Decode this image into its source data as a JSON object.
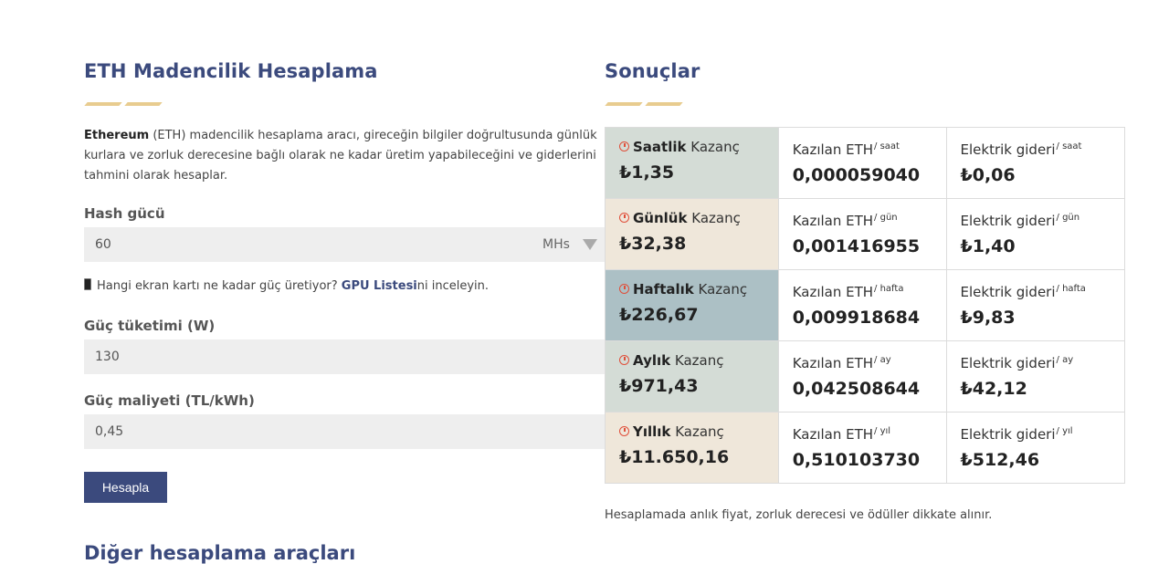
{
  "calculator": {
    "title": "ETH Madencilik Hesaplama",
    "intro_bold": "Ethereum",
    "intro_rest": " (ETH) madencilik hesaplama aracı, gireceğin bilgiler doğrultusunda günlük kurlara ve zorluk derecesine bağlı olarak ne kadar üretim yapabileceğini ve giderlerini tahmini olarak hesaplar.",
    "hash_label": "Hash gücü",
    "hash_value": "60",
    "hash_unit": "MHs",
    "gpu_note_prefix": "Hangi ekran kartı ne kadar güç üretiyor? ",
    "gpu_link": "GPU Listesi",
    "gpu_note_suffix": "ni inceleyin.",
    "power_label": "Güç tüketimi (W)",
    "power_value": "130",
    "cost_label": "Güç maliyeti (TL/kWh)",
    "cost_value": "0,45",
    "button_label": "Hesapla",
    "other_tools_title": "Diğer hesaplama araçları"
  },
  "results": {
    "title": "Sonuçlar",
    "earning_word": "Kazanç",
    "eth_label": "Kazılan ETH",
    "electric_label": "Elektrik gideri",
    "rows": [
      {
        "period": "Saatlik",
        "unit": "/ saat",
        "earning": "₺1,35",
        "eth": "0,000059040",
        "electric": "₺0,06",
        "color": "#d4dcd6"
      },
      {
        "period": "Günlük",
        "unit": "/ gün",
        "earning": "₺32,38",
        "eth": "0,001416955",
        "electric": "₺1,40",
        "color": "#efe7da"
      },
      {
        "period": "Haftalık",
        "unit": "/ hafta",
        "earning": "₺226,67",
        "eth": "0,009918684",
        "electric": "₺9,83",
        "color": "#acc0c5"
      },
      {
        "period": "Aylık",
        "unit": "/ ay",
        "earning": "₺971,43",
        "eth": "0,042508644",
        "electric": "₺42,12",
        "color": "#d4dcd6"
      },
      {
        "period": "Yıllık",
        "unit": "/ yıl",
        "earning": "₺11.650,16",
        "eth": "0,510103730",
        "electric": "₺512,46",
        "color": "#efe7da"
      }
    ],
    "note": "Hesaplamada anlık fiyat, zorluk derecesi ve ödüller dikkate alınır."
  },
  "colors": {
    "accent": "#3b4a7d",
    "gold": "#e8cc8f",
    "clock": "#e04f3a"
  }
}
